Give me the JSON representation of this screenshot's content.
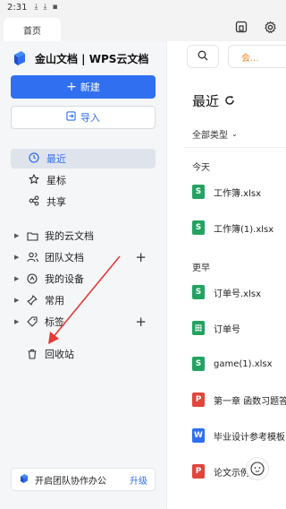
{
  "status_bar": {
    "time": "2:31"
  },
  "tabs": {
    "home_label": "首页"
  },
  "brand": {
    "name": "金山文档 | WPS云文档"
  },
  "actions": {
    "new_label": "新建",
    "import_label": "导入"
  },
  "nav": [
    {
      "label": "最近",
      "icon": "clock-icon"
    },
    {
      "label": "星标",
      "icon": "star-icon"
    },
    {
      "label": "共享",
      "icon": "share-icon"
    }
  ],
  "tree": [
    {
      "label": "我的云文档",
      "icon": "folder-icon"
    },
    {
      "label": "团队文档",
      "icon": "team-icon"
    },
    {
      "label": "我的设备",
      "icon": "device-icon"
    },
    {
      "label": "常用",
      "icon": "pin-icon"
    },
    {
      "label": "标签",
      "icon": "tag-icon"
    },
    {
      "label": "回收站",
      "icon": "trash-icon"
    }
  ],
  "promo": {
    "text": "开启团队协作办公",
    "upgrade": "升级"
  },
  "topbar": {
    "member_label": "会..."
  },
  "recent": {
    "title": "最近",
    "filter": "全部类型",
    "today_label": "今天",
    "earlier_label": "更早",
    "today_files": [
      {
        "name": "工作簿.xlsx",
        "type": "S"
      },
      {
        "name": "工作簿(1).xlsx",
        "type": "S"
      }
    ],
    "earlier_files": [
      {
        "name": "订单号.xlsx",
        "type": "S"
      },
      {
        "name": "订单号",
        "type": "田"
      },
      {
        "name": "game(1).xlsx",
        "type": "S"
      },
      {
        "name": "第一章  函数习题答案",
        "type": "P"
      },
      {
        "name": "毕业设计参考模板",
        "type": "W"
      },
      {
        "name": "论文示例",
        "type": "P"
      }
    ]
  },
  "colors": {
    "accent": "#2f6ff0",
    "sheet": "#24a262",
    "pdf": "#e0453c",
    "member": "#f08a24",
    "annotation_arrow": "#e53935"
  }
}
